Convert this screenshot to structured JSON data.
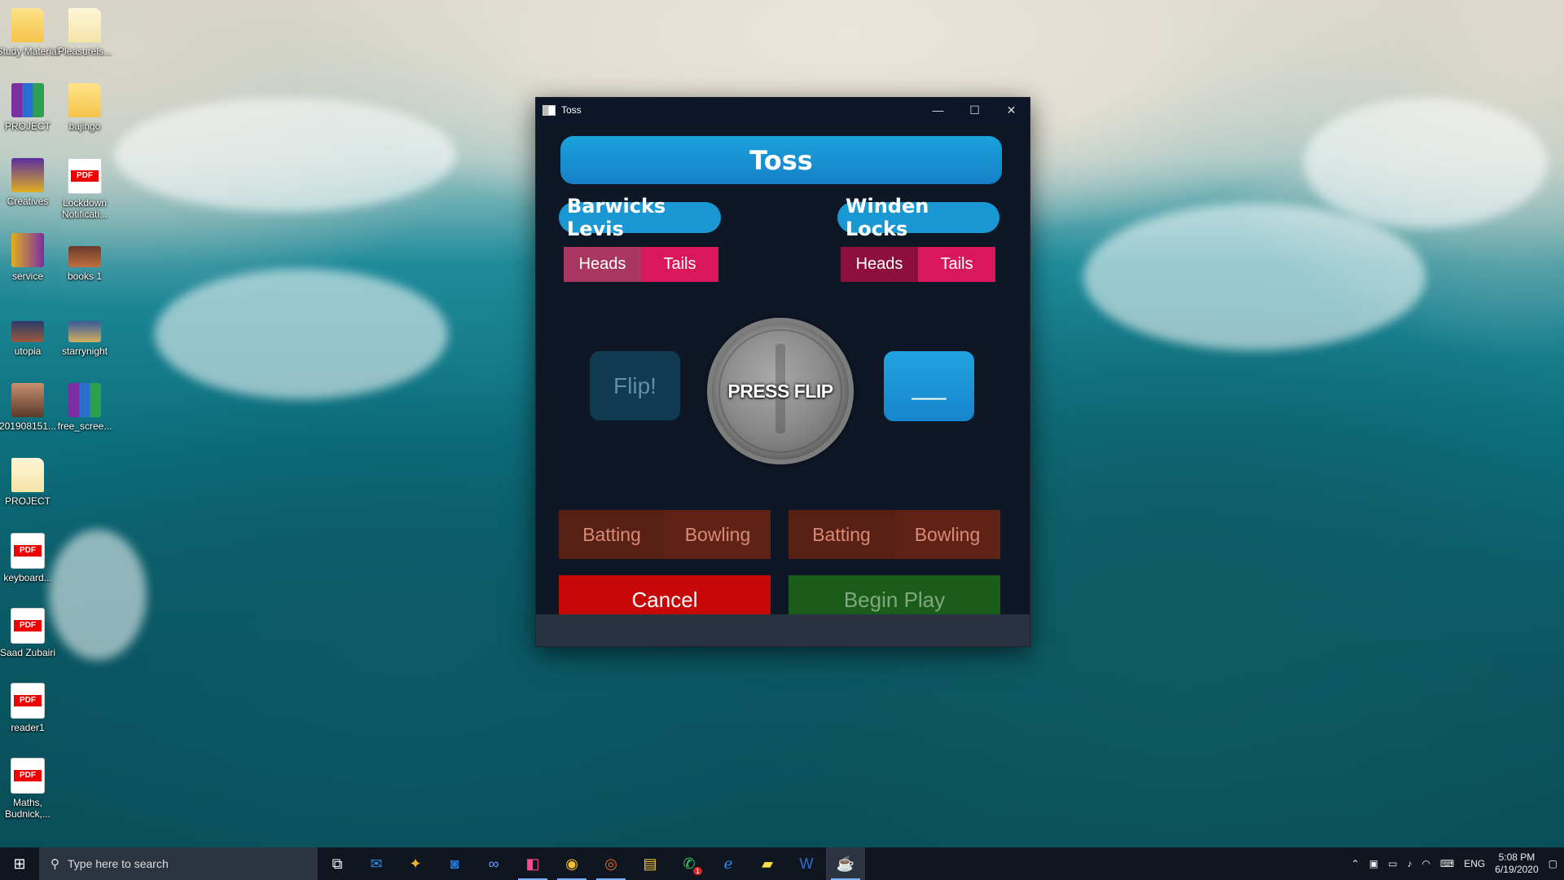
{
  "desktop": {
    "icons": [
      {
        "label": "Study Material"
      },
      {
        "label": "Pleasurels..."
      },
      {
        "label": "PROJECT"
      },
      {
        "label": "bajingo"
      },
      {
        "label": "Creatives"
      },
      {
        "label": "Lockdown Notificati..."
      },
      {
        "label": "service"
      },
      {
        "label": "books 1"
      },
      {
        "label": "utopia"
      },
      {
        "label": "starrynight"
      },
      {
        "label": "201908151..."
      },
      {
        "label": "free_scree..."
      },
      {
        "label": "PROJECT"
      },
      {
        "label": "keyboard..."
      },
      {
        "label": "Saad Zubairi"
      },
      {
        "label": "reader1"
      },
      {
        "label": "Maths, Budnick,..."
      }
    ]
  },
  "window": {
    "title": "Toss",
    "minimize": "—",
    "maximize": "☐",
    "close": "✕"
  },
  "toss": {
    "header": "Toss",
    "team1": {
      "name": "Barwicks Levis",
      "heads": "Heads",
      "tails": "Tails",
      "batting": "Batting",
      "bowling": "Bowling"
    },
    "team2": {
      "name": "Winden Locks",
      "heads": "Heads",
      "tails": "Tails",
      "batting": "Batting",
      "bowling": "Bowling"
    },
    "flip_label": "Flip!",
    "coin_label": "PRESS FLIP",
    "result_label": "___",
    "cancel_label": "Cancel",
    "begin_label": "Begin Play"
  },
  "colors": {
    "header_blue": "#1a98d4",
    "heads_selected": "#a8365e",
    "tails": "#d8185a",
    "heads_dark": "#8c0f3c",
    "cancel_red": "#c80808",
    "begin_green": "#1b5c1b"
  },
  "taskbar": {
    "search_placeholder": "Type here to search",
    "apps": [
      "task-view-icon",
      "mail-icon",
      "photos-icon",
      "outlook-icon",
      "infinity-icon",
      "intellij-icon",
      "chrome-icon",
      "media-icon",
      "file-explorer-icon",
      "whatsapp-icon",
      "edge-icon",
      "sticky-notes-icon",
      "word-icon",
      "java-icon"
    ],
    "whatsapp_badge": "1",
    "language": "ENG",
    "time": "5:08 PM",
    "date": "6/19/2020"
  }
}
